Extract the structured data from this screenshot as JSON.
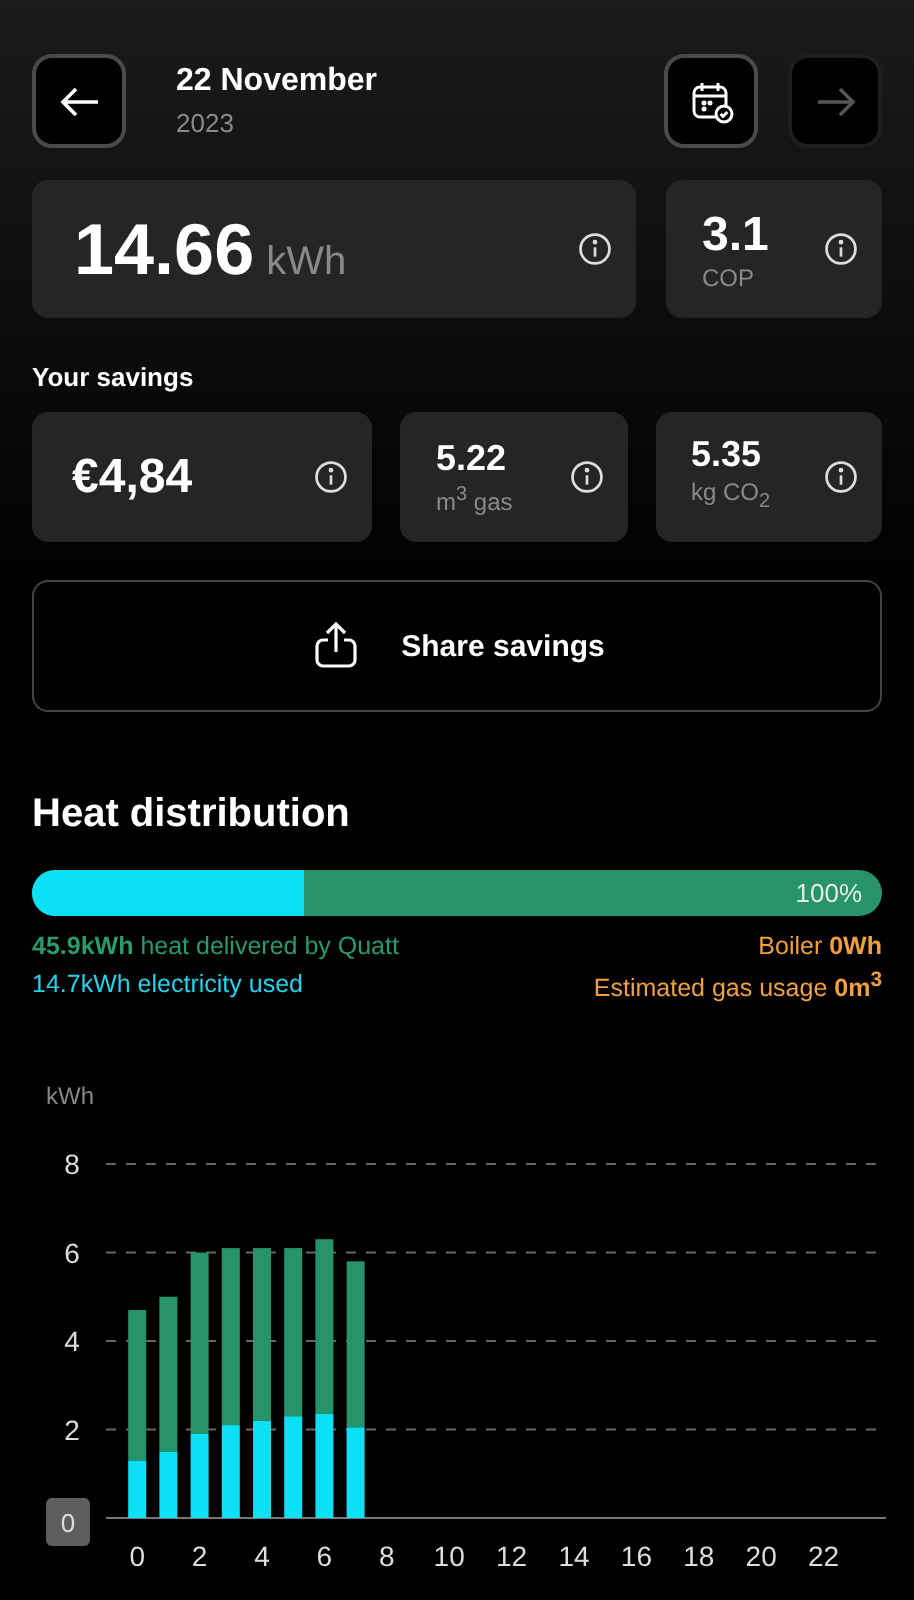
{
  "header": {
    "date": "22 November",
    "year": "2023",
    "back_button": {
      "disabled": false
    },
    "forward_button": {
      "disabled": true
    }
  },
  "energy": {
    "value": "14.66",
    "unit": "kWh"
  },
  "cop": {
    "value": "3.1",
    "label": "COP"
  },
  "savings": {
    "title": "Your savings",
    "cards": [
      {
        "value": "€4,84",
        "kind": "money"
      },
      {
        "value": "5.22",
        "unit": "m$^{3}$ gas",
        "kind": "amount"
      },
      {
        "value": "5.35",
        "unit": "kg CO$_{2}$",
        "kind": "amount"
      }
    ]
  },
  "share_button": {
    "label": "Share savings"
  },
  "heat_distribution": {
    "title": "Heat distribution",
    "level": 0.32,
    "percent": "100%",
    "legend": [
      {
        "text": "**45.9kWh** heat delivered by Quatt",
        "color": "#2a9a6c"
      },
      {
        "text": "Boiler **0Wh**",
        "color": "#f0a040"
      },
      {
        "text": "14.7kWh electricity used",
        "color": "#22d3ee"
      },
      {
        "text": "Estimated gas usage **0m$^{3}$**",
        "color": "#f0a040"
      }
    ]
  },
  "chart_data": {
    "type": "bar",
    "stacked": true,
    "ylabel": "kWh",
    "x": [
      0,
      1,
      2,
      3,
      4,
      5,
      6,
      7
    ],
    "series": [
      {
        "color": "#0de0f4",
        "values": [
          1.3,
          1.5,
          1.9,
          2.1,
          2.2,
          2.3,
          2.35,
          2.05
        ]
      },
      {
        "color": "#27936a",
        "values": [
          3.4,
          3.5,
          4.1,
          4.0,
          3.9,
          3.8,
          3.95,
          3.75
        ]
      }
    ],
    "xlim": [
      -1,
      24
    ],
    "ylim": [
      0,
      8
    ],
    "grid": true,
    "xticks": [
      0,
      2,
      4,
      6,
      8,
      10,
      12,
      14,
      16,
      18,
      20,
      22
    ],
    "yticks": [
      0,
      2,
      4,
      6,
      8
    ]
  }
}
